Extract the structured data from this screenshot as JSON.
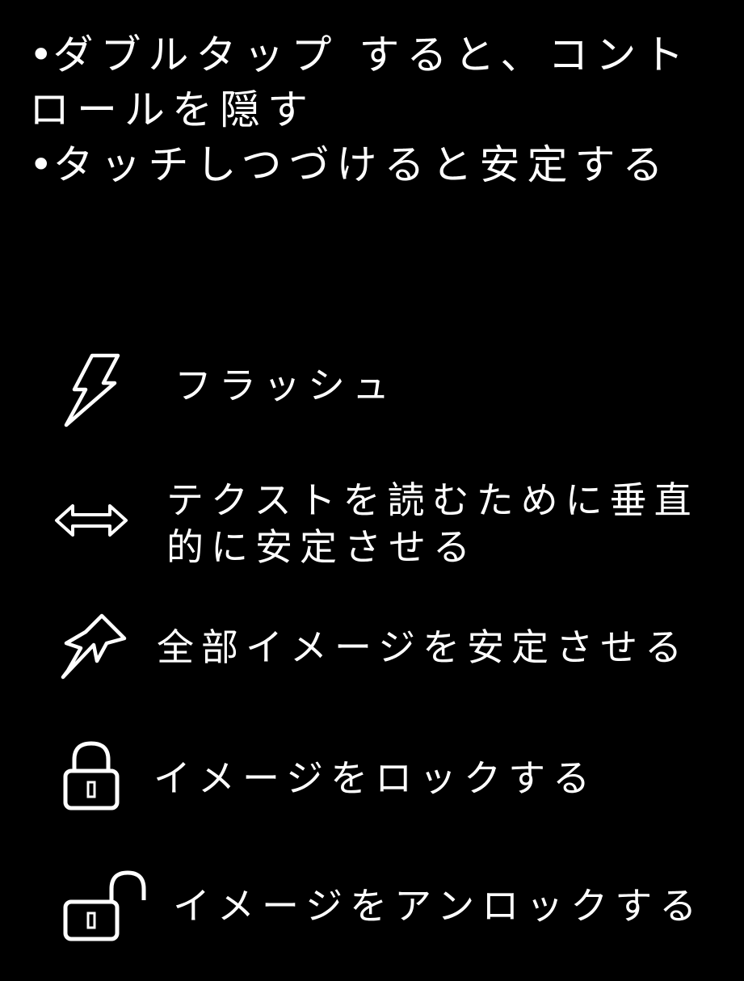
{
  "instructions": {
    "bullet": "•",
    "items": [
      "ダブルタップ すると、コントロールを隠す",
      "タッチしつづけると安定する"
    ]
  },
  "legend": {
    "flash": {
      "icon": "lightning-bolt-icon",
      "label": "フラッシュ"
    },
    "vertical_stabilize": {
      "icon": "horizontal-double-arrow-icon",
      "label": "テクストを読むために垂直的に安定させる"
    },
    "stabilize_all": {
      "icon": "pushpin-icon",
      "label": "全部イメージを安定させる"
    },
    "lock": {
      "icon": "lock-closed-icon",
      "label": "イメージをロックする"
    },
    "unlock": {
      "icon": "lock-open-icon",
      "label": "イメージをアンロックする"
    }
  },
  "colors": {
    "background": "#000000",
    "foreground": "#ffffff"
  }
}
